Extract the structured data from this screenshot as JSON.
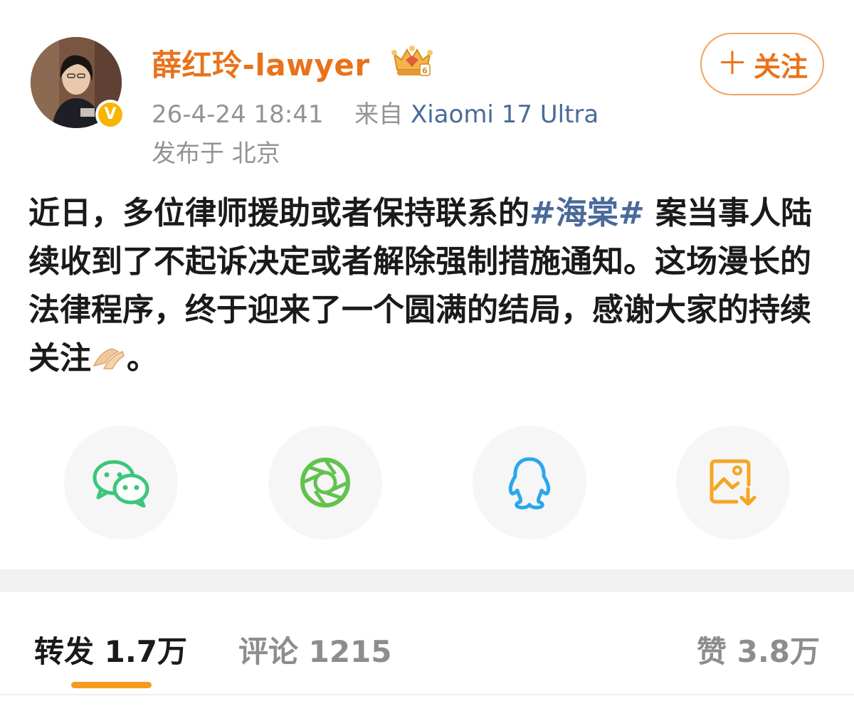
{
  "post": {
    "username": "薛红玲-lawyer",
    "timestamp": "26-4-24 18:41",
    "from_label": "来自",
    "device": "Xiaomi 17 Ultra",
    "location": "发布于 北京",
    "follow_label": "关注",
    "follow_icon": "plus-icon",
    "verified_icon": "V",
    "content": {
      "part1": "近日，多位律师援助或者保持联系的",
      "hashtag": "#海棠#",
      "part2": " 案当事人陆续收到了不起诉决定或者解除强制措施通知。这场漫长的法律程序，终于迎来了一个圆满的结局，感谢大家的持续关注",
      "emoji": "pinched-fingers-emoji",
      "part3": "。"
    }
  },
  "share": [
    {
      "icon": "wechat-icon",
      "color": "#3cc67c"
    },
    {
      "icon": "moments-icon",
      "color": "#62c24e"
    },
    {
      "icon": "qq-icon",
      "color": "#29a8ec"
    },
    {
      "icon": "save-image-icon",
      "color": "#f5a623"
    }
  ],
  "tabs": {
    "forward": "转发 1.7万",
    "comment": "评论 1215",
    "like": "赞 3.8万"
  },
  "colors": {
    "accent": "#e8731c",
    "link": "#4a6a9a",
    "muted": "#939393",
    "underline": "#f59a1e"
  }
}
